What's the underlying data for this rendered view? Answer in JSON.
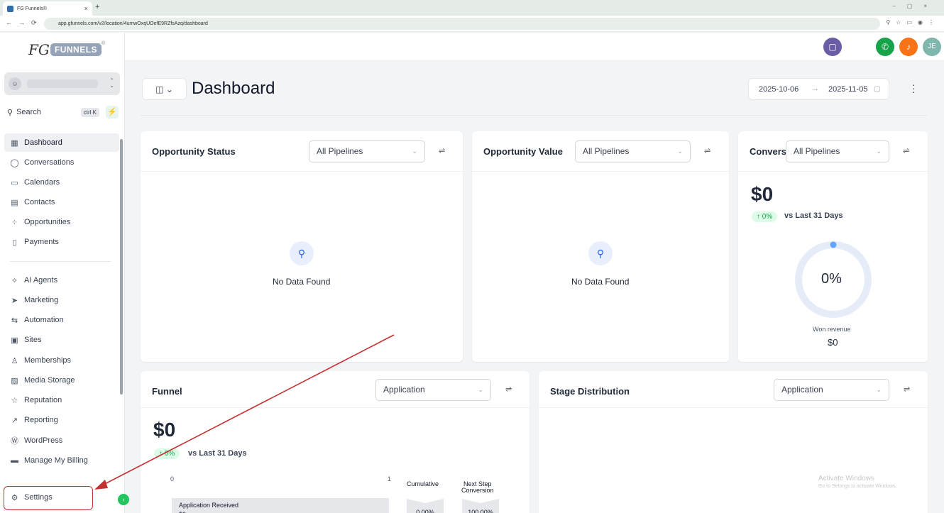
{
  "browser": {
    "tab_title": "FG Funnels®",
    "url": "app.gfunnels.com/v2/location/4umwOxqUOefE9RZfsAzq/dashboard"
  },
  "brand": {
    "mark": "FG",
    "word": "FUNNELS",
    "reg": "®"
  },
  "header": {
    "user_initials": "JE"
  },
  "sidebar": {
    "search_label": "Search",
    "search_shortcut": "ctrl K",
    "items": [
      {
        "label": "Dashboard",
        "icon": "grid-icon",
        "glyph": "▦"
      },
      {
        "label": "Conversations",
        "icon": "chat-bubble-icon",
        "glyph": "◯"
      },
      {
        "label": "Calendars",
        "icon": "calendar-icon",
        "glyph": "▭"
      },
      {
        "label": "Contacts",
        "icon": "contacts-icon",
        "glyph": "▤"
      },
      {
        "label": "Opportunities",
        "icon": "opportunities-icon",
        "glyph": "⁘"
      },
      {
        "label": "Payments",
        "icon": "receipt-icon",
        "glyph": "▯"
      },
      {
        "label": "AI Agents",
        "icon": "sparkle-icon",
        "glyph": "✧"
      },
      {
        "label": "Marketing",
        "icon": "send-icon",
        "glyph": "➤"
      },
      {
        "label": "Automation",
        "icon": "automation-icon",
        "glyph": "⇆"
      },
      {
        "label": "Sites",
        "icon": "sites-icon",
        "glyph": "▣"
      },
      {
        "label": "Memberships",
        "icon": "badge-icon",
        "glyph": "♙"
      },
      {
        "label": "Media Storage",
        "icon": "image-icon",
        "glyph": "▨"
      },
      {
        "label": "Reputation",
        "icon": "star-icon",
        "glyph": "☆"
      },
      {
        "label": "Reporting",
        "icon": "trend-icon",
        "glyph": "↗"
      },
      {
        "label": "WordPress",
        "icon": "wordpress-icon",
        "glyph": "Ⓦ"
      },
      {
        "label": "Manage My Billing",
        "icon": "billing-icon",
        "glyph": "▬"
      },
      {
        "label": "Settings",
        "icon": "gear-icon",
        "glyph": "⚙"
      }
    ]
  },
  "dashboard": {
    "title": "Dashboard",
    "date_start": "2025-10-06",
    "date_end": "2025-11-05"
  },
  "cards": {
    "opp_status": {
      "title": "Opportunity Status",
      "select": "All Pipelines",
      "empty": "No Data Found"
    },
    "opp_value": {
      "title": "Opportunity Value",
      "select": "All Pipelines",
      "empty": "No Data Found"
    },
    "conversion": {
      "title": "Convers",
      "select": "All Pipelines",
      "amount": "$0",
      "change": "↑ 0%",
      "vs": "vs Last 31 Days",
      "donut_pct": "0%",
      "donut_value": 0,
      "won_label": "Won revenue",
      "won_value": "$0"
    },
    "funnel": {
      "title": "Funnel",
      "select": "Application",
      "amount": "$0",
      "change": "↑ 0%",
      "vs": "vs Last 31 Days",
      "axis_min": "0",
      "axis_max": "1",
      "stage": "Application Received",
      "stage_sub": "$0",
      "col1": "Cumulative",
      "col2a": "Next Step",
      "col2b": "Conversion",
      "cum_val": "0.00%",
      "next_val": "100.00%"
    },
    "stage_dist": {
      "title": "Stage Distribution",
      "select": "Application"
    }
  },
  "watermark": {
    "line1": "Activate Windows",
    "line2": "Go to Settings to activate Windows."
  },
  "colors": {
    "accent_green": "#22c55e",
    "annotation_red": "#c53030",
    "chat_purple": "#6b5ca5",
    "bell_orange": "#f97316"
  }
}
